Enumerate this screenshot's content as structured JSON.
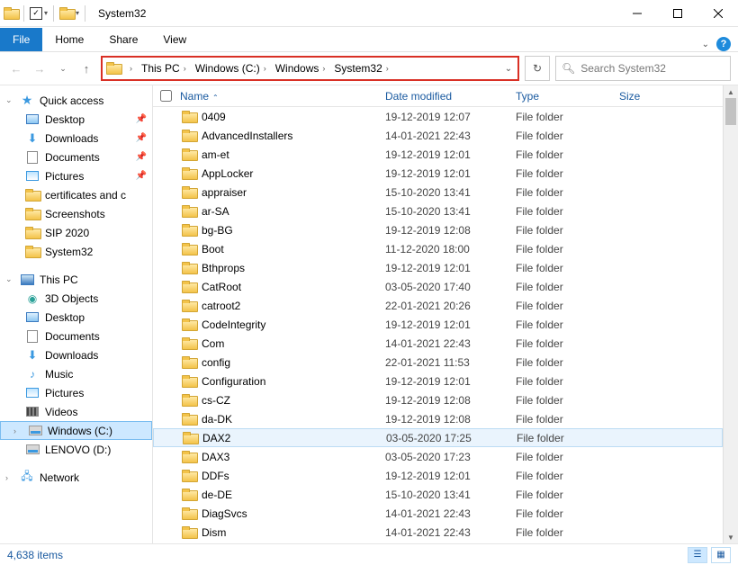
{
  "window": {
    "title": "System32"
  },
  "ribbon": {
    "file": "File",
    "home": "Home",
    "share": "Share",
    "view": "View"
  },
  "breadcrumb": [
    "This PC",
    "Windows (C:)",
    "Windows",
    "System32"
  ],
  "search": {
    "placeholder": "Search System32"
  },
  "sidebar": {
    "quick": {
      "label": "Quick access",
      "items": [
        {
          "label": "Desktop",
          "pinned": true,
          "icon": "monitor"
        },
        {
          "label": "Downloads",
          "pinned": true,
          "icon": "dl"
        },
        {
          "label": "Documents",
          "pinned": true,
          "icon": "doc"
        },
        {
          "label": "Pictures",
          "pinned": true,
          "icon": "pic"
        },
        {
          "label": "certificates and c",
          "pinned": false,
          "icon": "folder"
        },
        {
          "label": "Screenshots",
          "pinned": false,
          "icon": "folder"
        },
        {
          "label": "SIP 2020",
          "pinned": false,
          "icon": "folder"
        },
        {
          "label": "System32",
          "pinned": false,
          "icon": "folder"
        }
      ]
    },
    "thispc": {
      "label": "This PC",
      "items": [
        {
          "label": "3D Objects",
          "icon": "3d"
        },
        {
          "label": "Desktop",
          "icon": "monitor"
        },
        {
          "label": "Documents",
          "icon": "doc"
        },
        {
          "label": "Downloads",
          "icon": "dl"
        },
        {
          "label": "Music",
          "icon": "music"
        },
        {
          "label": "Pictures",
          "icon": "pic"
        },
        {
          "label": "Videos",
          "icon": "video"
        },
        {
          "label": "Windows (C:)",
          "icon": "drive",
          "selected": true
        },
        {
          "label": "LENOVO (D:)",
          "icon": "drive"
        }
      ]
    },
    "network": {
      "label": "Network"
    }
  },
  "columns": {
    "name": "Name",
    "date": "Date modified",
    "type": "Type",
    "size": "Size"
  },
  "files": [
    {
      "name": "0409",
      "date": "19-12-2019 12:07",
      "type": "File folder"
    },
    {
      "name": "AdvancedInstallers",
      "date": "14-01-2021 22:43",
      "type": "File folder"
    },
    {
      "name": "am-et",
      "date": "19-12-2019 12:01",
      "type": "File folder"
    },
    {
      "name": "AppLocker",
      "date": "19-12-2019 12:01",
      "type": "File folder"
    },
    {
      "name": "appraiser",
      "date": "15-10-2020 13:41",
      "type": "File folder"
    },
    {
      "name": "ar-SA",
      "date": "15-10-2020 13:41",
      "type": "File folder"
    },
    {
      "name": "bg-BG",
      "date": "19-12-2019 12:08",
      "type": "File folder"
    },
    {
      "name": "Boot",
      "date": "11-12-2020 18:00",
      "type": "File folder"
    },
    {
      "name": "Bthprops",
      "date": "19-12-2019 12:01",
      "type": "File folder"
    },
    {
      "name": "CatRoot",
      "date": "03-05-2020 17:40",
      "type": "File folder"
    },
    {
      "name": "catroot2",
      "date": "22-01-2021 20:26",
      "type": "File folder"
    },
    {
      "name": "CodeIntegrity",
      "date": "19-12-2019 12:01",
      "type": "File folder"
    },
    {
      "name": "Com",
      "date": "14-01-2021 22:43",
      "type": "File folder"
    },
    {
      "name": "config",
      "date": "22-01-2021 11:53",
      "type": "File folder"
    },
    {
      "name": "Configuration",
      "date": "19-12-2019 12:01",
      "type": "File folder"
    },
    {
      "name": "cs-CZ",
      "date": "19-12-2019 12:08",
      "type": "File folder"
    },
    {
      "name": "da-DK",
      "date": "19-12-2019 12:08",
      "type": "File folder"
    },
    {
      "name": "DAX2",
      "date": "03-05-2020 17:25",
      "type": "File folder",
      "highlight": true
    },
    {
      "name": "DAX3",
      "date": "03-05-2020 17:23",
      "type": "File folder"
    },
    {
      "name": "DDFs",
      "date": "19-12-2019 12:01",
      "type": "File folder"
    },
    {
      "name": "de-DE",
      "date": "15-10-2020 13:41",
      "type": "File folder"
    },
    {
      "name": "DiagSvcs",
      "date": "14-01-2021 22:43",
      "type": "File folder"
    },
    {
      "name": "Dism",
      "date": "14-01-2021 22:43",
      "type": "File folder"
    }
  ],
  "status": {
    "count": "4,638 items"
  }
}
